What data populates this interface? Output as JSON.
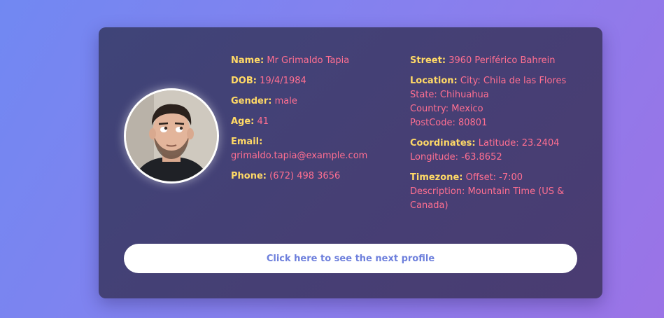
{
  "profile": {
    "name_label": "Name:",
    "name": "Mr Grimaldo Tapia",
    "dob_label": "DOB:",
    "dob": "19/4/1984",
    "gender_label": "Gender:",
    "gender": "male",
    "age_label": "Age:",
    "age": "41",
    "email_label": "Email:",
    "email": "grimaldo.tapia@example.com",
    "phone_label": "Phone:",
    "phone": "(672) 498 3656",
    "street_label": "Street:",
    "street": "3960 Periférico Bahrein",
    "location_label": "Location:",
    "city": "City: Chila de las Flores",
    "state": "State: Chihuahua",
    "country": "Country: Mexico",
    "postcode": "PostCode: 80801",
    "coordinates_label": "Coordinates:",
    "latitude": "Latitude: 23.2404",
    "longitude": "Longitude: -63.8652",
    "timezone_label": "Timezone:",
    "offset": "Offset: -7:00",
    "description": "Description: Mountain Time (US & Canada)"
  },
  "button": {
    "next_label": "Click here to see the next profile"
  },
  "colors": {
    "label": "#ffd966",
    "value": "#ff6f91",
    "button_text": "#6d7fdc"
  },
  "icons": {
    "avatar": "profile-photo"
  }
}
